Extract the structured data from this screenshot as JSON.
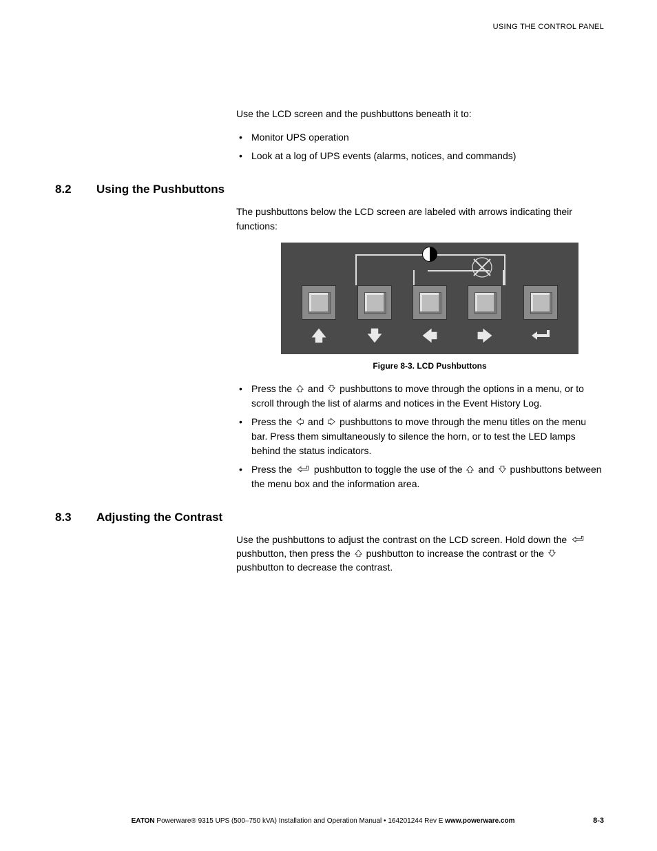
{
  "running_head": "USING THE CONTROL PANEL",
  "intro": {
    "lead": "Use the LCD screen and the pushbuttons beneath it to:",
    "bullets": [
      "Monitor UPS operation",
      "Look at a log of UPS events (alarms, notices, and commands)"
    ]
  },
  "section_8_2": {
    "number": "8.2",
    "title": "Using the Pushbuttons",
    "para": "The pushbuttons below the LCD screen are labeled with arrows indicating their functions:",
    "figure_caption": "Figure 8-3.  LCD Pushbuttons",
    "arrow_icons": [
      "arrow-up-icon",
      "arrow-down-icon",
      "arrow-left-icon",
      "arrow-right-icon",
      "enter-icon"
    ],
    "bullets": [
      {
        "pre": "Press the ",
        "icon1": "up",
        "mid1": " and ",
        "icon2": "down",
        "post": " pushbuttons to move through the options in a menu, or to scroll through the list of alarms and notices in the Event History Log."
      },
      {
        "pre": "Press the ",
        "icon1": "left",
        "mid1": " and ",
        "icon2": "right",
        "post": " pushbuttons to move through the menu titles on the menu bar. Press them simultaneously to silence the horn, or to test the LED lamps behind the status indicators."
      },
      {
        "pre": "Press the ",
        "icon1": "enter",
        "mid1": " pushbutton to toggle the use of the ",
        "icon2": "up",
        "mid2": " and ",
        "icon3": "down",
        "post": " pushbuttons between the menu box and the information area."
      }
    ]
  },
  "section_8_3": {
    "number": "8.3",
    "title": "Adjusting the Contrast",
    "para_pre": "Use the pushbuttons to adjust the contrast on the LCD screen. Hold down the ",
    "para_icon1": "enter",
    "para_mid1": " pushbutton, then press the ",
    "para_icon2": "up",
    "para_mid2": " pushbutton to increase the contrast or the ",
    "para_icon3": "down",
    "para_post": " pushbutton to decrease the contrast."
  },
  "footer": {
    "brand": "EATON",
    "product": " Powerware® 9315 UPS (500–750 kVA) Installation and Operation Manual",
    "sep": "  •  ",
    "docnum": "164201244 Rev E ",
    "url": "www.powerware.com",
    "page": "8-3"
  }
}
